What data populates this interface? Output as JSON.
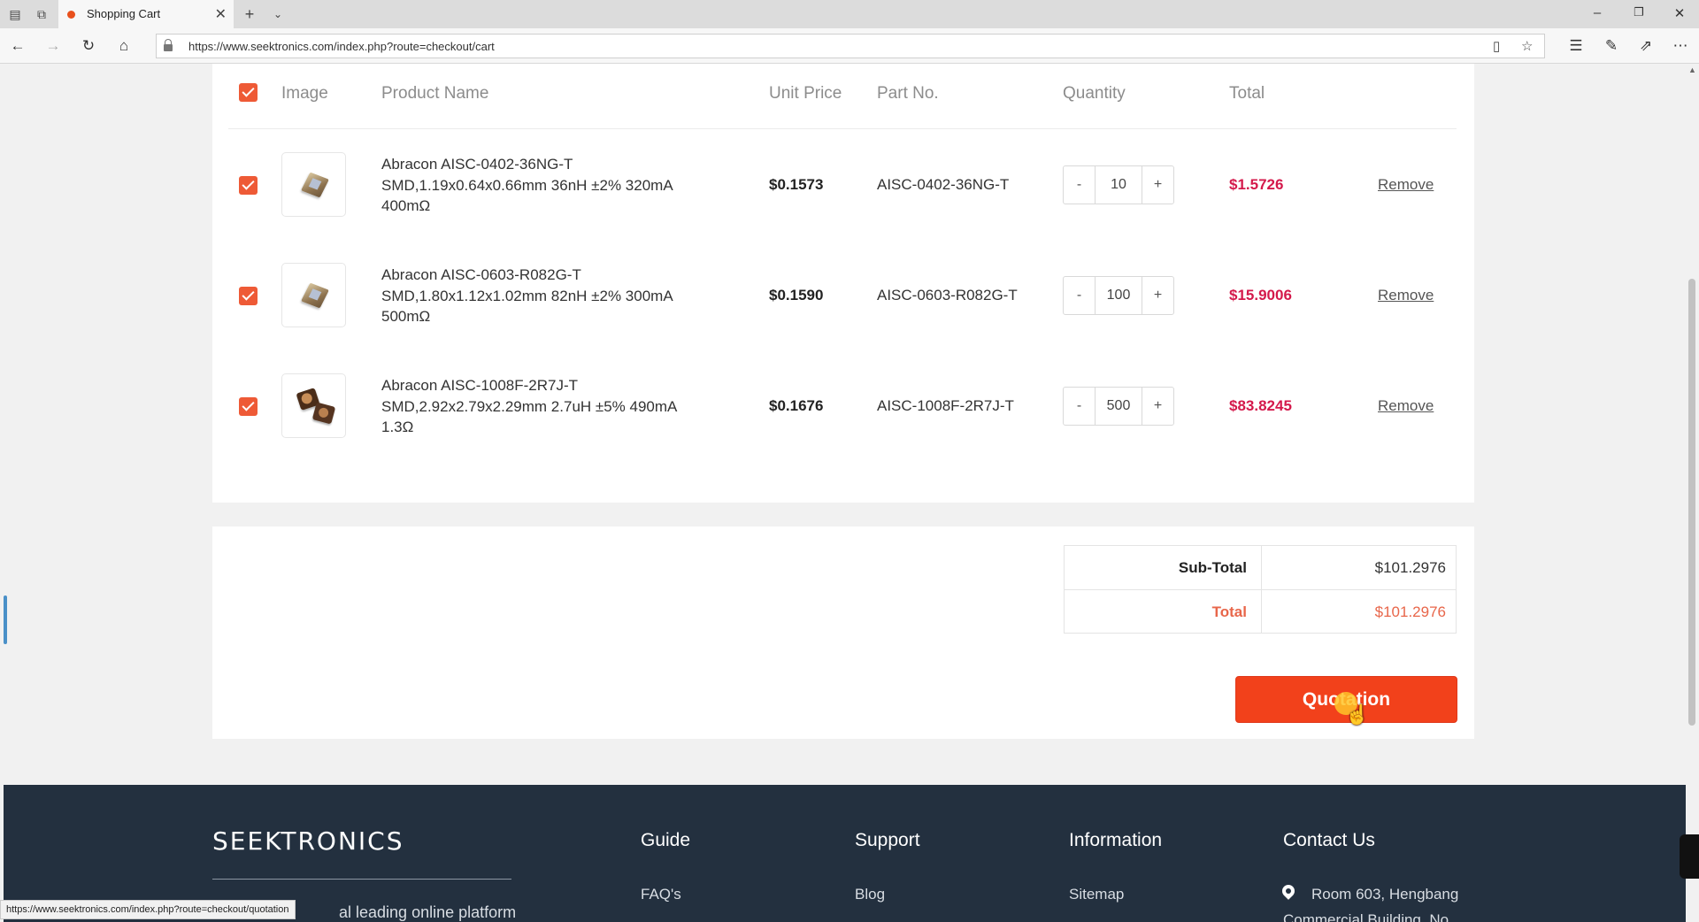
{
  "browser": {
    "tab_title": "Shopping Cart",
    "url": "https://www.seektronics.com/index.php?route=checkout/cart",
    "status_url": "https://www.seektronics.com/index.php?route=checkout/quotation"
  },
  "cart": {
    "headers": {
      "image": "Image",
      "product_name": "Product Name",
      "unit_price": "Unit Price",
      "part_no": "Part No.",
      "quantity": "Quantity",
      "total": "Total"
    },
    "remove_label": "Remove",
    "qty_minus": "-",
    "qty_plus": "+",
    "items": [
      {
        "name_line1": "Abracon AISC-0402-36NG-T",
        "name_line2": "SMD,1.19x0.64x0.66mm 36nH ±2% 320mA",
        "name_line3": "400mΩ",
        "unit_price": "$0.1573",
        "part_no": "AISC-0402-36NG-T",
        "quantity": "10",
        "total": "$1.5726"
      },
      {
        "name_line1": "Abracon AISC-0603-R082G-T",
        "name_line2": "SMD,1.80x1.12x1.02mm 82nH ±2% 300mA",
        "name_line3": "500mΩ",
        "unit_price": "$0.1590",
        "part_no": "AISC-0603-R082G-T",
        "quantity": "100",
        "total": "$15.9006"
      },
      {
        "name_line1": "Abracon AISC-1008F-2R7J-T",
        "name_line2": "SMD,2.92x2.79x2.29mm 2.7uH ±5% 490mA",
        "name_line3": "1.3Ω",
        "unit_price": "$0.1676",
        "part_no": "AISC-1008F-2R7J-T",
        "quantity": "500",
        "total": "$83.8245"
      }
    ]
  },
  "summary": {
    "subtotal_label": "Sub-Total",
    "subtotal_value": "$101.2976",
    "total_label": "Total",
    "total_value": "$101.2976",
    "quotation_label": "Quotation"
  },
  "footer": {
    "logo": "SEEKTRONICS",
    "tagline_visible": "al leading online platform",
    "guide_heading": "Guide",
    "support_heading": "Support",
    "information_heading": "Information",
    "contact_heading": "Contact Us",
    "guide_link": "FAQ's",
    "support_link": "Blog",
    "information_link": "Sitemap",
    "address_line1": "Room 603, Hengbang",
    "address_line2": "Commercial Building, No."
  },
  "colors": {
    "accent": "#f2411b",
    "price_total": "#d4194b",
    "summary_total": "#e8664a",
    "footer_bg": "#23303f",
    "checkbox": "#ee5a36"
  }
}
